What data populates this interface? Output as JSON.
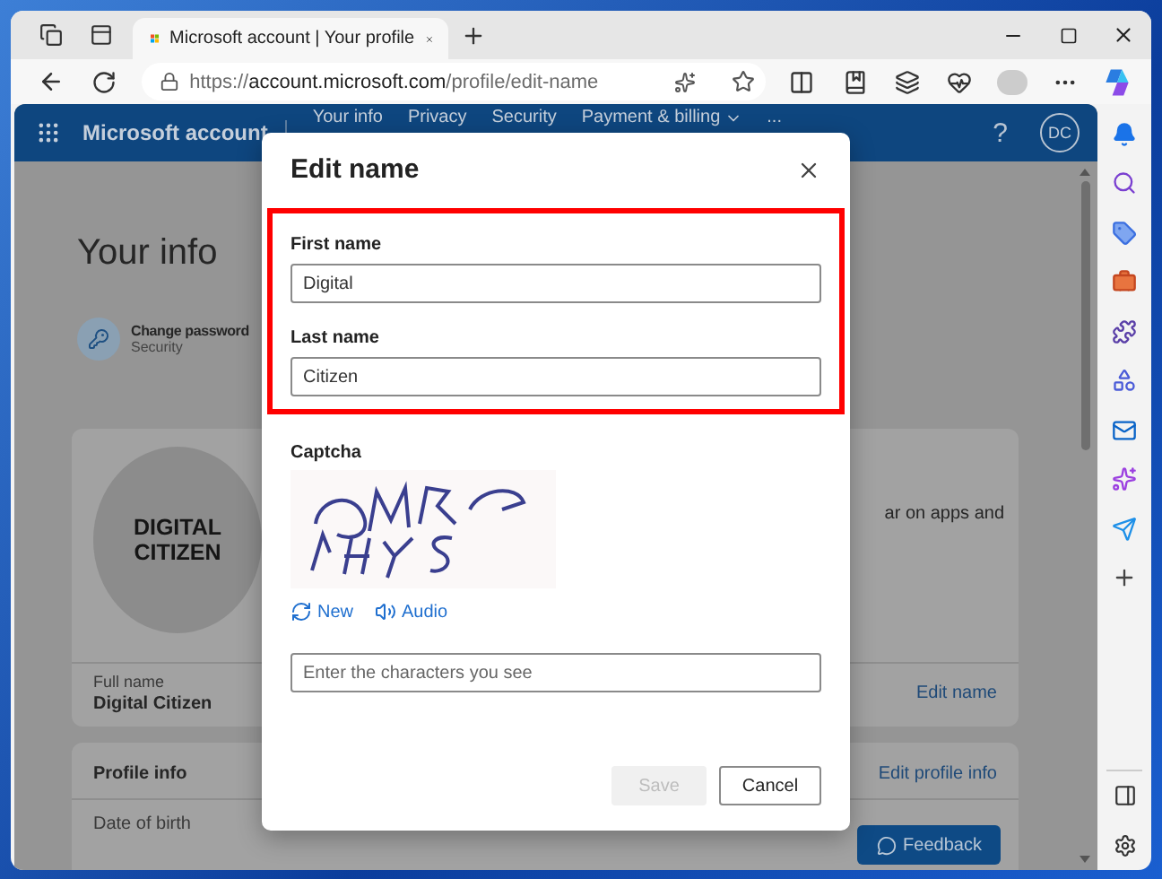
{
  "browser": {
    "tabs": [
      {
        "title": "Microsoft account | Your profile",
        "selected": true
      }
    ],
    "url": {
      "scheme": "https://",
      "host": "account.microsoft.com",
      "path": "/profile/edit-name"
    }
  },
  "header": {
    "brand": "Microsoft account",
    "nav": [
      "Your info",
      "Privacy",
      "Security",
      "Payment & billing",
      "..."
    ],
    "help": "?",
    "avatar": "DC"
  },
  "page": {
    "title": "Your info",
    "quick_link": {
      "title": "Change password",
      "subtitle": "Security"
    },
    "profile_card": {
      "logo_lines": [
        "DIGITAL",
        "CITIZEN"
      ],
      "side_text": "ar on apps and",
      "field_label": "Full name",
      "field_value": "Digital Citizen",
      "action": "Edit name"
    },
    "profile_info": {
      "title": "Profile info",
      "action": "Edit profile info",
      "field_label": "Date of birth"
    },
    "feedback": "Feedback"
  },
  "dialog": {
    "title": "Edit name",
    "fields_highlighted": true,
    "fields": [
      {
        "label": "First name",
        "value": "Digital"
      },
      {
        "label": "Last name",
        "value": "Citizen"
      }
    ],
    "captcha": {
      "label": "Captcha",
      "links": [
        {
          "label": "New",
          "kind": "refresh"
        },
        {
          "label": "Audio",
          "kind": "audio"
        }
      ],
      "placeholder": "Enter the characters you see"
    },
    "buttons": [
      {
        "label": "Save",
        "disabled": true
      },
      {
        "label": "Cancel",
        "disabled": false
      }
    ]
  }
}
